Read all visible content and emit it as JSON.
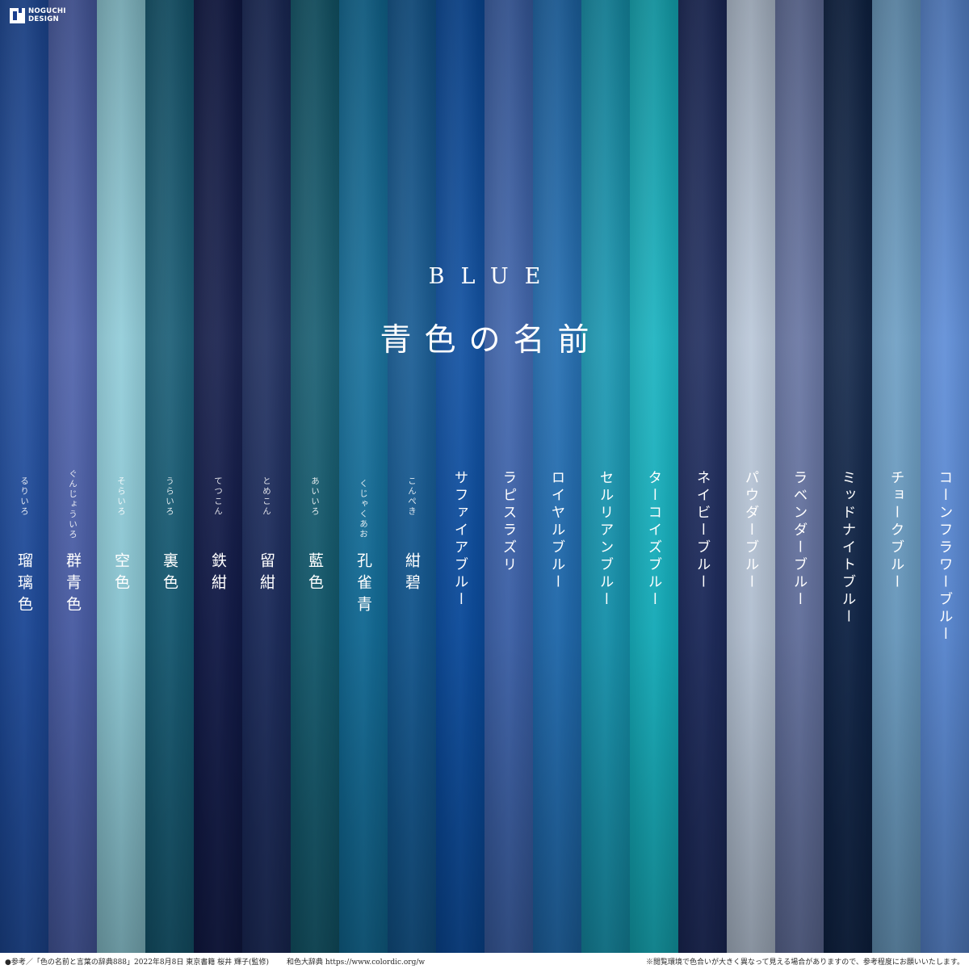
{
  "logo": {
    "line1": "NOGUCHI",
    "line2": "DESIGN"
  },
  "title": {
    "en": "BLUE",
    "jp": "青色の名前"
  },
  "colors": [
    {
      "name": "瑠璃色",
      "ruby": "るりいろ",
      "hex": "#1e4b9c"
    },
    {
      "name": "群青色",
      "ruby": "ぐんじょういろ",
      "hex": "#4a5ea8"
    },
    {
      "name": "空色",
      "ruby": "そらいろ",
      "hex": "#8ecbd8"
    },
    {
      "name": "裏色",
      "ruby": "うらいろ",
      "hex": "#155a73"
    },
    {
      "name": "鉄紺",
      "ruby": "てつこん",
      "hex": "#111a48"
    },
    {
      "name": "留紺",
      "ruby": "とめこん",
      "hex": "#1b2b5c"
    },
    {
      "name": "藍色",
      "ruby": "あいいろ",
      "hex": "#135a6e"
    },
    {
      "name": "孔雀青",
      "ruby": "くじゃくあお",
      "hex": "#116c98"
    },
    {
      "name": "紺碧",
      "ruby": "こんぺき",
      "hex": "#125790"
    },
    {
      "name": "サファイアブルー",
      "ruby": "",
      "hex": "#0a4c9f"
    },
    {
      "name": "ラピスラズリ",
      "ruby": "",
      "hex": "#3c62ab"
    },
    {
      "name": "ロイヤルブルー",
      "ruby": "",
      "hex": "#1f6bb0"
    },
    {
      "name": "セルリアンブルー",
      "ruby": "",
      "hex": "#1695b0"
    },
    {
      "name": "ターコイズブルー",
      "ruby": "",
      "hex": "#14b0be"
    },
    {
      "name": "ネイビーブルー",
      "ruby": "",
      "hex": "#1c2a5c"
    },
    {
      "name": "パウダーブルー",
      "ruby": "",
      "hex": "#b8c6d8"
    },
    {
      "name": "ラベンダーブルー",
      "ruby": "",
      "hex": "#6472a0"
    },
    {
      "name": "ミッドナイトブルー",
      "ruby": "",
      "hex": "#0f2447"
    },
    {
      "name": "チョークブルー",
      "ruby": "",
      "hex": "#6a9cc2"
    },
    {
      "name": "コーンフラワーブルー",
      "ruby": "",
      "hex": "#5a8ad6"
    }
  ],
  "footer": {
    "reference": "●参考／「色の名前と言葉の辞典888」2022年8月8日 東京書籍 桜井 輝子(監修)",
    "site": "和色大辞典 https://www.colordic.org/w",
    "note": "※閲覧環境で色合いが大きく異なって見える場合がありますので、参考程度にお願いいたします。"
  }
}
